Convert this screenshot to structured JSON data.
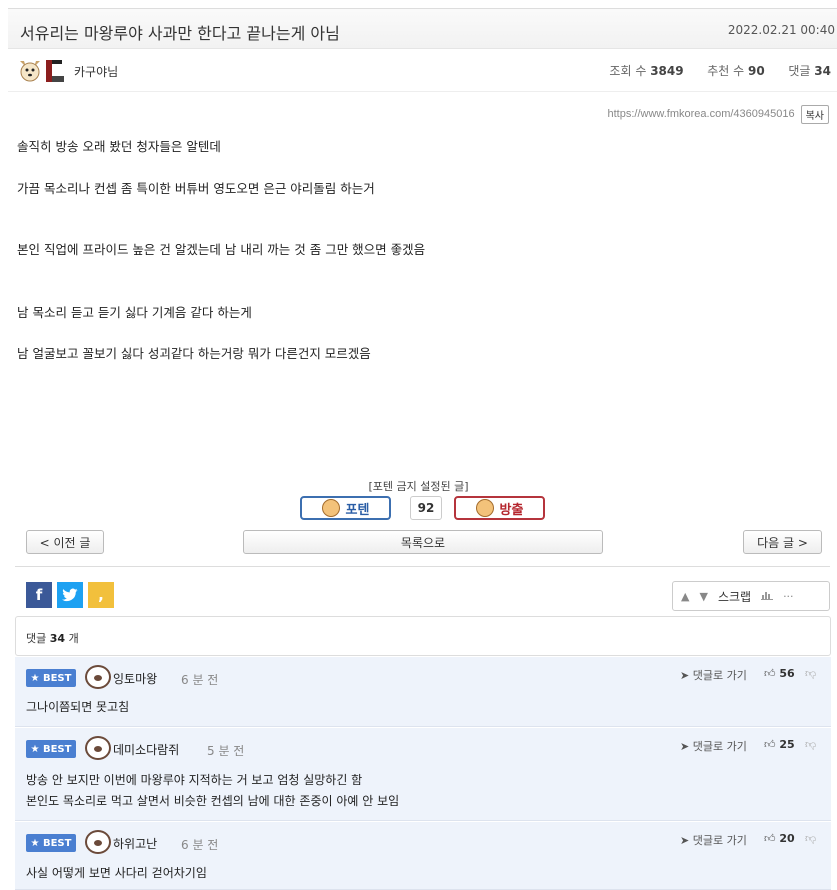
{
  "post": {
    "title": "서유리는 마왕루야 사과만 한다고 끝나는게 아님",
    "date": "2022.02.21 00:40",
    "author": "카구야님",
    "views_label": "조회 수",
    "views": "3849",
    "recommend_label": "추천 수",
    "recommend": "90",
    "comments_label": "댓글",
    "comments": "34",
    "url": "https://www.fmkorea.com/4360945016",
    "copy_label": "복사",
    "body": [
      "솔직히 방송 오래 봤던 청자들은 알텐데",
      "가끔 목소리나 컨셉 좀 특이한 버튜버 영도오면 은근 야리돌림 하는거",
      "본인 직업에 프라이드 높은 건 알겠는데 남 내리 까는 것 좀 그만 했으면 좋겠음",
      "남 목소리 듣고 듣기 싫다 기계음 같다 하는게",
      "남 얼굴보고 꼴보기 싫다 성괴같다 하는거랑 뭐가 다른건지 모르겠음"
    ]
  },
  "voting": {
    "fixed_note": "[포텐 금지 설정된 글]",
    "up_label": "포텐",
    "count": "92",
    "down_label": "방출"
  },
  "nav": {
    "prev_label": "< 이전 글",
    "list_label": "목록으로",
    "next_label": "다음 글 >"
  },
  "share": {
    "facebook": "f",
    "twitter": "t",
    "kakao": ","
  },
  "tools": {
    "up": "▲",
    "down": "▼",
    "scrap_label": "스크랩",
    "more": "···"
  },
  "comments_header": {
    "prefix": "댓글",
    "count": "34",
    "suffix": "개"
  },
  "comments": [
    {
      "badge": "★ BEST",
      "nick": "잉토마왕",
      "time": "6 분 전",
      "goto": "댓글로 가기",
      "likes": "56",
      "lines": [
        "그나이쯤되면 못고침"
      ]
    },
    {
      "badge": "★ BEST",
      "nick": "데미소다람쥐",
      "time": "5 분 전",
      "goto": "댓글로 가기",
      "likes": "25",
      "lines": [
        "방송 안 보지만 이번에 마왕루야 지적하는 거 보고 엄청 실망하긴 함",
        "본인도 목소리로 먹고 살면서 비슷한 컨셉의 남에 대한 존중이 아예 안 보임"
      ]
    },
    {
      "badge": "★ BEST",
      "nick": "하위고난",
      "time": "6 분 전",
      "goto": "댓글로 가기",
      "likes": "20",
      "lines": [
        "사실 어떻게 보면 사다리 걷어차기임"
      ]
    }
  ]
}
